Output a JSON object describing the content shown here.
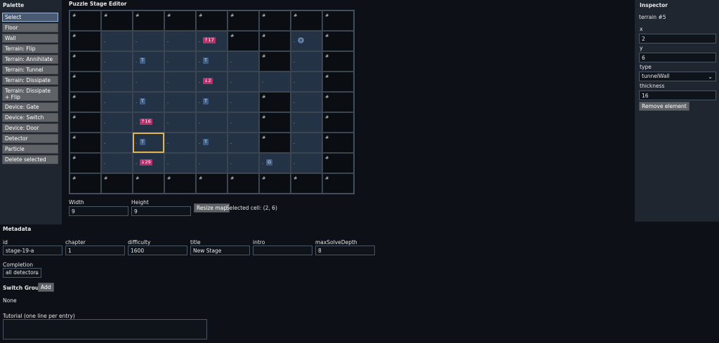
{
  "palette": {
    "title": "Palette",
    "items": [
      {
        "label": "Select",
        "active": true
      },
      {
        "label": "Floor"
      },
      {
        "label": "Wall"
      },
      {
        "label": "Terrain: Flip"
      },
      {
        "label": "Terrain: Annihilate"
      },
      {
        "label": "Terrain: Tunnel"
      },
      {
        "label": "Terrain: Dissipate"
      },
      {
        "label": "Terrain: Dissipate + Flip",
        "two_line": true
      },
      {
        "label": "Device: Gate"
      },
      {
        "label": "Device: Switch"
      },
      {
        "label": "Device: Door"
      },
      {
        "label": "Detector"
      },
      {
        "label": "Particle"
      },
      {
        "label": "Delete selected"
      }
    ]
  },
  "editor": {
    "title": "Puzzle Stage Editor",
    "grid": [
      [
        "#",
        "#",
        "#",
        "#",
        "#",
        "#",
        "#",
        "#",
        "#"
      ],
      [
        "#",
        ".",
        ".",
        ".",
        ".",
        "#",
        "#",
        ".",
        "#"
      ],
      [
        "#",
        ".",
        ".",
        ".",
        ".",
        ".",
        "#",
        ".",
        "#"
      ],
      [
        "#",
        ".",
        ".",
        ".",
        ".",
        ".",
        ".",
        ".",
        "#"
      ],
      [
        "#",
        ".",
        ".",
        ".",
        ".",
        ".",
        "#",
        ".",
        "#"
      ],
      [
        "#",
        ".",
        ".",
        ".",
        ".",
        ".",
        "#",
        ".",
        "#"
      ],
      [
        "#",
        ".",
        ".",
        ".",
        ".",
        ".",
        "#",
        ".",
        "#"
      ],
      [
        "#",
        ".",
        ".",
        ".",
        ".",
        ".",
        ".",
        ".",
        "#"
      ],
      [
        "#",
        "#",
        "#",
        "#",
        "#",
        "#",
        "#",
        "#",
        "#"
      ]
    ],
    "tokens": [
      {
        "row": 1,
        "col": 4,
        "text": "↑17",
        "kind": "arrow"
      },
      {
        "row": 1,
        "col": 7,
        "text": "◯",
        "kind": "circ"
      },
      {
        "row": 2,
        "col": 2,
        "text": "T",
        "kind": "t"
      },
      {
        "row": 2,
        "col": 4,
        "text": "T",
        "kind": "t"
      },
      {
        "row": 3,
        "col": 4,
        "text": "↓2",
        "kind": "arrow"
      },
      {
        "row": 4,
        "col": 2,
        "text": "T",
        "kind": "t"
      },
      {
        "row": 4,
        "col": 4,
        "text": "T",
        "kind": "t"
      },
      {
        "row": 5,
        "col": 2,
        "text": "↑16",
        "kind": "arrow"
      },
      {
        "row": 6,
        "col": 2,
        "text": "T",
        "kind": "t"
      },
      {
        "row": 6,
        "col": 4,
        "text": "T",
        "kind": "t"
      },
      {
        "row": 7,
        "col": 2,
        "text": "↓29",
        "kind": "arrow"
      },
      {
        "row": 7,
        "col": 6,
        "text": "G",
        "kind": "g"
      }
    ],
    "selected": {
      "row": 6,
      "col": 2
    },
    "width_label": "Width",
    "height_label": "Height",
    "width_value": "9",
    "height_value": "9",
    "resize_label": "Resize map",
    "selected_cell_text": "Selected cell: (2, 6)"
  },
  "inspector": {
    "title": "Inspector",
    "subtitle": "terrain #5",
    "fields": [
      {
        "label": "x",
        "value": "2"
      },
      {
        "label": "y",
        "value": "6"
      },
      {
        "label": "type",
        "value": "tunnelWall",
        "select": true
      },
      {
        "label": "thickness",
        "value": "16"
      }
    ],
    "remove_label": "Remove element"
  },
  "metadata": {
    "title": "Metadata",
    "fields": [
      {
        "label": "id",
        "value": "stage-19-a"
      },
      {
        "label": "chapter",
        "value": "1"
      },
      {
        "label": "difficulty",
        "value": "1600"
      },
      {
        "label": "title",
        "value": "New Stage"
      },
      {
        "label": "intro",
        "value": ""
      },
      {
        "label": "maxSolveDepth",
        "value": "8"
      }
    ],
    "completion_label": "Completion",
    "completion_value": "all detectors",
    "switch_groups_label": "Switch Groups",
    "add_label": "Add",
    "none_text": "None",
    "tutorial_label": "Tutorial (one line per entry)",
    "tutorial_value": ""
  },
  "colors": {
    "background": "#0d1117",
    "panel": "#1f2630",
    "floor_cell": "#243246",
    "wall_cell": "#0a0d12",
    "arrow_token": "#b5326b",
    "tunnel_token": "#3f5d82",
    "selection": "#e0b64a",
    "button": "#5f6367"
  }
}
